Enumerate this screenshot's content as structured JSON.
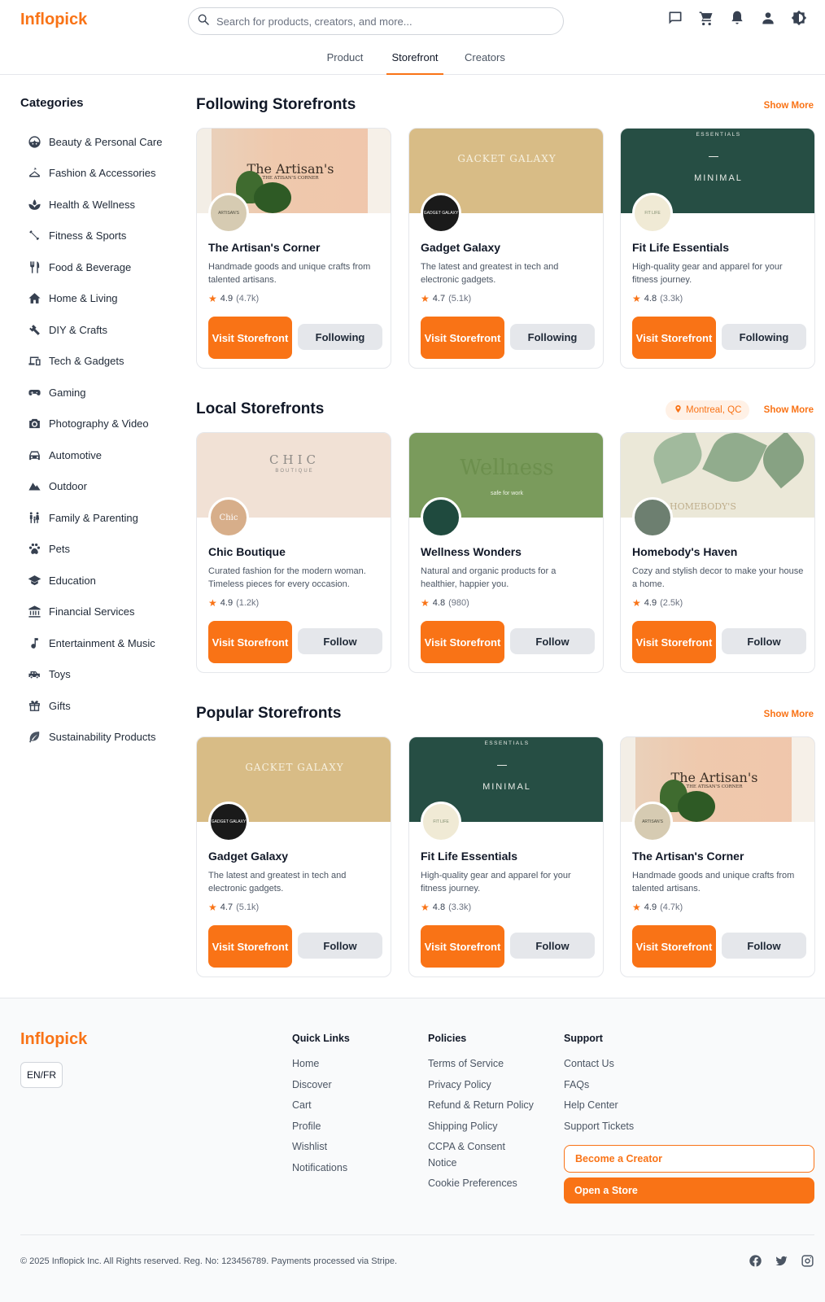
{
  "header": {
    "logo": "Inflopick",
    "search_placeholder": "Search for products, creators, and more...",
    "tabs": [
      {
        "label": "Product"
      },
      {
        "label": "Storefront"
      },
      {
        "label": "Creators"
      }
    ],
    "active_tab": "Storefront",
    "icons": [
      "chat-icon",
      "cart-icon",
      "bell-icon",
      "user-icon",
      "theme-toggle-icon"
    ]
  },
  "sidebar": {
    "title": "Categories",
    "items": [
      {
        "label": "Beauty & Personal Care",
        "icon": "face-icon"
      },
      {
        "label": "Fashion & Accessories",
        "icon": "hanger-icon"
      },
      {
        "label": "Health & Wellness",
        "icon": "spa-icon"
      },
      {
        "label": "Fitness & Sports",
        "icon": "dumbbell-icon"
      },
      {
        "label": "Food & Beverage",
        "icon": "utensils-icon"
      },
      {
        "label": "Home & Living",
        "icon": "house-icon"
      },
      {
        "label": "DIY & Crafts",
        "icon": "tools-icon"
      },
      {
        "label": "Tech & Gadgets",
        "icon": "devices-icon"
      },
      {
        "label": "Gaming",
        "icon": "gamepad-icon"
      },
      {
        "label": "Photography & Video",
        "icon": "camera-icon"
      },
      {
        "label": "Automotive",
        "icon": "car-icon"
      },
      {
        "label": "Outdoor",
        "icon": "mountain-icon"
      },
      {
        "label": "Family & Parenting",
        "icon": "family-icon"
      },
      {
        "label": "Pets",
        "icon": "paw-icon"
      },
      {
        "label": "Education",
        "icon": "graduation-cap-icon"
      },
      {
        "label": "Financial Services",
        "icon": "bank-icon"
      },
      {
        "label": "Entertainment & Music",
        "icon": "music-note-icon"
      },
      {
        "label": "Toys",
        "icon": "toy-car-icon"
      },
      {
        "label": "Gifts",
        "icon": "gift-icon"
      },
      {
        "label": "Sustainability Products",
        "icon": "leaf-icon"
      }
    ]
  },
  "sections": {
    "following": {
      "title": "Following Storefronts",
      "show_more": "Show More",
      "cards": [
        {
          "name": "The Artisan's Corner",
          "desc": "Handmade goods and unique crafts from talented artisans.",
          "rating": "4.9",
          "count": "(4.7k)",
          "visit": "Visit Storefront",
          "follow": "Following",
          "banner": "artisan",
          "banner_text": "The Artisan's",
          "banner_sub": "THE ATISAN'S CORNER",
          "avatar_text": "ARTISAN'S"
        },
        {
          "name": "Gadget Galaxy",
          "desc": "The latest and greatest in tech and electronic gadgets.",
          "rating": "4.7",
          "count": "(5.1k)",
          "visit": "Visit Storefront",
          "follow": "Following",
          "banner": "gadget",
          "banner_text": "GACKET GALAXY",
          "banner_sub": "",
          "avatar_text": "GADGET GALAXY"
        },
        {
          "name": "Fit Life Essentials",
          "desc": "High-quality gear and apparel for your fitness journey.",
          "rating": "4.8",
          "count": "(3.3k)",
          "visit": "Visit Storefront",
          "follow": "Following",
          "banner": "minimal",
          "banner_text": "MINIMAL",
          "banner_sub": "ESSENTIALS",
          "avatar_text": "FIT LIFE"
        }
      ]
    },
    "local": {
      "title": "Local Storefronts",
      "show_more": "Show More",
      "location": "Montreal, QC",
      "cards": [
        {
          "name": "Chic Boutique",
          "desc": "Curated fashion for the modern woman. Timeless pieces for every occasion.",
          "rating": "4.9",
          "count": "(1.2k)",
          "visit": "Visit Storefront",
          "follow": "Follow",
          "banner": "chic",
          "banner_text": "CHIC",
          "banner_sub": "BOUTIQUE",
          "avatar_text": "Chic"
        },
        {
          "name": "Wellness Wonders",
          "desc": "Natural and organic products for a healthier, happier you.",
          "rating": "4.8",
          "count": "(980)",
          "visit": "Visit Storefront",
          "follow": "Follow",
          "banner": "wellness",
          "banner_text": "Wellness",
          "banner_sub": "safe for work",
          "avatar_text": ""
        },
        {
          "name": "Homebody's Haven",
          "desc": "Cozy and stylish decor to make your house a home.",
          "rating": "4.9",
          "count": "(2.5k)",
          "visit": "Visit Storefront",
          "follow": "Follow",
          "banner": "homebody",
          "banner_text": "HOMEBODY'S",
          "banner_sub": "",
          "avatar_text": ""
        }
      ]
    },
    "popular": {
      "title": "Popular Storefronts",
      "show_more": "Show More",
      "cards": [
        {
          "name": "Gadget Galaxy",
          "desc": "The latest and greatest in tech and electronic gadgets.",
          "rating": "4.7",
          "count": "(5.1k)",
          "visit": "Visit Storefront",
          "follow": "Follow",
          "banner": "gadget",
          "banner_text": "GACKET GALAXY",
          "banner_sub": "",
          "avatar_text": "GADGET GALAXY"
        },
        {
          "name": "Fit Life Essentials",
          "desc": "High-quality gear and apparel for your fitness journey.",
          "rating": "4.8",
          "count": "(3.3k)",
          "visit": "Visit Storefront",
          "follow": "Follow",
          "banner": "minimal",
          "banner_text": "MINIMAL",
          "banner_sub": "ESSENTIALS",
          "avatar_text": "FIT LIFE"
        },
        {
          "name": "The Artisan's Corner",
          "desc": "Handmade goods and unique crafts from talented artisans.",
          "rating": "4.9",
          "count": "(4.7k)",
          "visit": "Visit Storefront",
          "follow": "Follow",
          "banner": "artisan",
          "banner_text": "The Artisan's",
          "banner_sub": "THE ATISAN'S CORNER",
          "avatar_text": "ARTISAN'S"
        }
      ]
    }
  },
  "footer": {
    "logo": "Inflopick",
    "lang": "EN/FR",
    "quick_links": {
      "title": "Quick Links",
      "links": [
        "Home",
        "Discover",
        "Cart",
        "Profile",
        "Wishlist",
        "Notifications"
      ]
    },
    "policies": {
      "title": "Policies",
      "links": [
        "Terms of Service",
        "Privacy Policy",
        "Refund & Return Policy",
        "Shipping Policy",
        "CCPA & Consent Notice",
        "Cookie Preferences"
      ]
    },
    "support": {
      "title": "Support",
      "links": [
        "Contact Us",
        "FAQs",
        "Help Center",
        "Support Tickets"
      ]
    },
    "become_creator": "Become a Creator",
    "open_store": "Open a Store",
    "copyright": "© 2025 Inflopick Inc. All Rights reserved. Reg. No: 123456789. Payments processed via Stripe.",
    "social": [
      "facebook-icon",
      "twitter-icon",
      "instagram-icon"
    ]
  },
  "colors": {
    "accent": "#f97316",
    "button_gray": "#e5e7eb",
    "text": "#111827"
  }
}
